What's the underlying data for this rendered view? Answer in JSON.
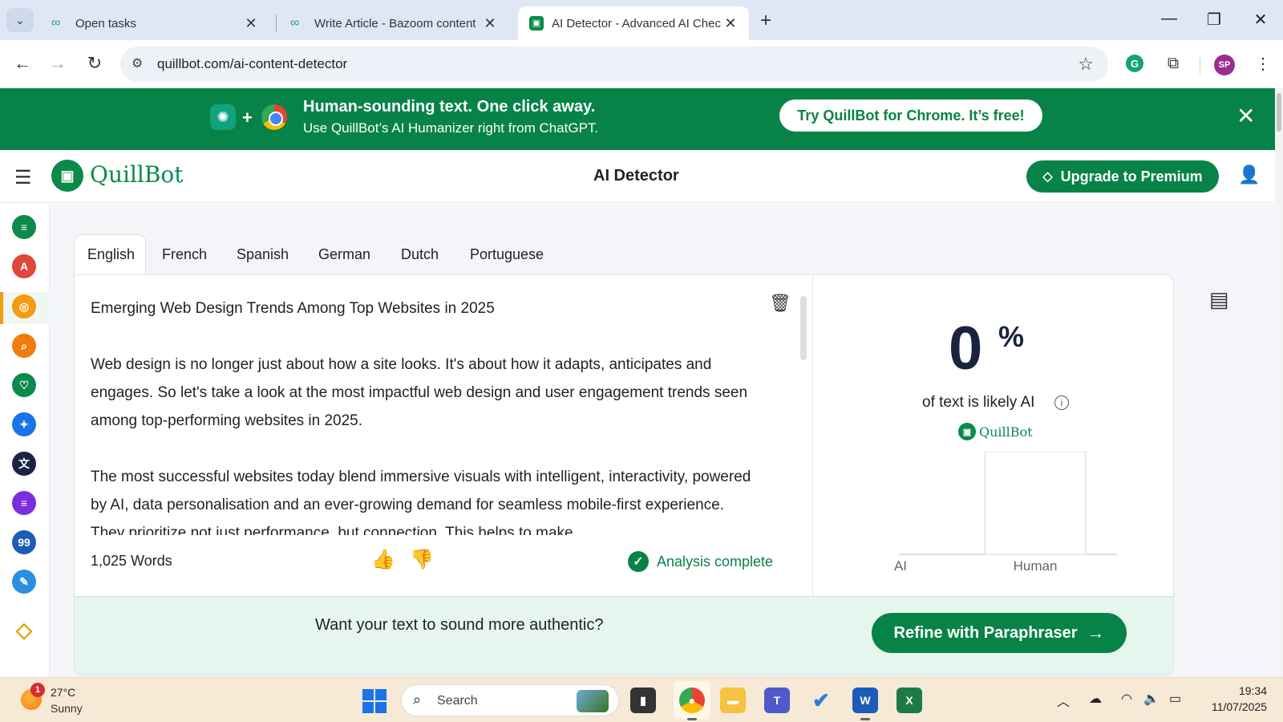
{
  "browser": {
    "tabs": [
      {
        "label": "Open tasks",
        "active": false
      },
      {
        "label": "Write Article - Bazoom content",
        "active": false
      },
      {
        "label": "AI Detector - Advanced AI Chec",
        "active": true
      }
    ],
    "url": "quillbot.com/ai-content-detector"
  },
  "promo": {
    "headline": "Human-sounding text. One click away.",
    "subline": "Use QuillBot’s AI Humanizer right from ChatGPT.",
    "cta": "Try QuillBot for Chrome. It’s free!"
  },
  "header": {
    "brand": "QuillBot",
    "title": "AI Detector",
    "upgrade": "Upgrade to Premium"
  },
  "languages": [
    "English",
    "French",
    "Spanish",
    "German",
    "Dutch",
    "Portuguese"
  ],
  "editor": {
    "paragraphs": [
      "Emerging Web Design Trends Among Top Websites in 2025",
      "Web design is no longer just about how a site looks. It's about how it adapts, anticipates and engages. So let's take a look at the most impactful web design and user engagement trends seen among top-performing websites in 2025.",
      "The most successful websites today blend immersive visuals with intelligent, interactivity, powered by AI, data personalisation and an ever-growing demand for seamless mobile-first experience. They prioritize not just performance, but connection. This helps to make"
    ],
    "word_count": "1,025 Words",
    "status": "Analysis complete"
  },
  "result": {
    "percent": "0",
    "percent_sign": "%",
    "label": "of text is likely AI",
    "brand": "QuillBot"
  },
  "chart_data": {
    "type": "bar",
    "categories": [
      "AI",
      "Human"
    ],
    "values": [
      0,
      100
    ],
    "ylim": [
      0,
      100
    ],
    "grid": false
  },
  "cta": {
    "text": "Want your text to sound more authentic?",
    "button": "Refine with Paraphraser"
  },
  "taskbar": {
    "temp": "27°C",
    "condition": "Sunny",
    "weather_badge": "1",
    "search": "Search",
    "time": "19:34",
    "date": "11/07/2025"
  },
  "colors": {
    "brand_green": "#078347",
    "cta_bg": "#e6f6ee"
  }
}
